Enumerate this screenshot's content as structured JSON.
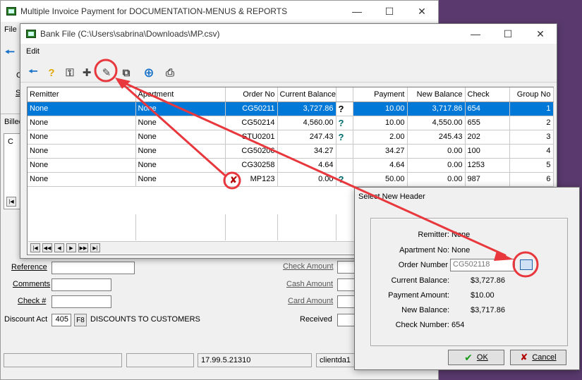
{
  "main_window": {
    "title": "Multiple Invoice Payment for DOCUMENTATION-MENUS & REPORTS",
    "menu_file": "File",
    "frag_c": "C",
    "frag_s": "S",
    "frag_billed": "Billed",
    "frag_c2": "C",
    "form": {
      "reference_label": "Reference",
      "comments_label": "Comments",
      "check_label": "Check #",
      "discount_label": "Discount Act",
      "discount_value": "405",
      "f8": "F8",
      "discount_desc": "DISCOUNTS TO CUSTOMERS",
      "check_amount_label": "Check Amount",
      "cash_amount_label": "Cash Amount",
      "card_amount_label": "Card Amount",
      "received_label": "Received"
    },
    "status": {
      "version": "17.99.5.21310",
      "client": "clientda1"
    }
  },
  "bank_window": {
    "title": "Bank File (C:\\Users\\sabrina\\Downloads\\MP.csv)",
    "menu_edit": "Edit",
    "columns": [
      "Remitter",
      "Apartment",
      "Order No",
      "Current Balance",
      "",
      "Payment",
      "New Balance",
      "Check",
      "Group No"
    ],
    "rows": [
      {
        "remitter": "None",
        "apartment": "None",
        "order": "CG50211",
        "balance": "3,727.86",
        "help": "?",
        "payment": "10.00",
        "new_balance": "3,717.86",
        "check": "654",
        "group": "1"
      },
      {
        "remitter": "None",
        "apartment": "None",
        "order": "CG50214",
        "balance": "4,560.00",
        "help": "?",
        "payment": "10.00",
        "new_balance": "4,550.00",
        "check": "655",
        "group": "2"
      },
      {
        "remitter": "None",
        "apartment": "None",
        "order": "STU0201",
        "balance": "247.43",
        "help": "?",
        "payment": "2.00",
        "new_balance": "245.43",
        "check": "202",
        "group": "3"
      },
      {
        "remitter": "None",
        "apartment": "None",
        "order": "CG50206",
        "balance": "34.27",
        "help": "",
        "payment": "34.27",
        "new_balance": "0.00",
        "check": "100",
        "group": "4"
      },
      {
        "remitter": "None",
        "apartment": "None",
        "order": "CG30258",
        "balance": "4.64",
        "help": "",
        "payment": "4.64",
        "new_balance": "0.00",
        "check": "1253",
        "group": "5"
      },
      {
        "remitter": "None",
        "apartment": "None",
        "order": "MP123",
        "balance": "0.00",
        "help": "?",
        "payment": "50.00",
        "new_balance": "0.00",
        "check": "987",
        "group": "6"
      }
    ]
  },
  "dialog": {
    "title": "Select New Header",
    "remitter_label": "Remitter:",
    "remitter_value": "None",
    "apartment_label": "Apartment No:",
    "apartment_value": "None",
    "order_label": "Order Number",
    "order_value": "CG502118",
    "balance_label": "Current Balance:",
    "balance_value": "$3,727.86",
    "payment_label": "Payment Amount:",
    "payment_value": "$10.00",
    "new_balance_label": "New Balance:",
    "new_balance_value": "$3,717.86",
    "check_label": "Check Number:",
    "check_value": "654",
    "ok_label": "OK",
    "cancel_label": "Cancel"
  },
  "colors": {
    "selection": "#0078d7",
    "annotation": "#e8383d",
    "background": "#5a3a6e"
  }
}
